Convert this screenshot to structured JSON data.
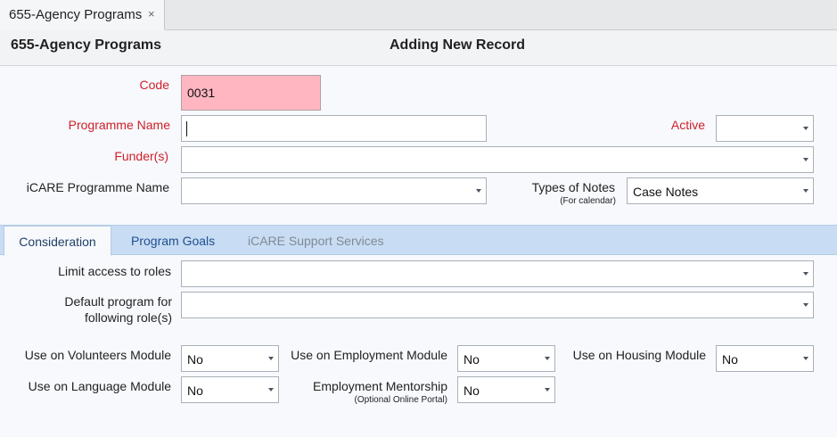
{
  "doc_tab": {
    "label": "655-Agency Programs",
    "close": "×"
  },
  "header": {
    "form_title": "655-Agency Programs",
    "mode": "Adding New Record"
  },
  "fields": {
    "code": {
      "label": "Code",
      "value": "0031"
    },
    "programme_name": {
      "label": "Programme Name",
      "value": ""
    },
    "active": {
      "label": "Active",
      "value": ""
    },
    "funders": {
      "label": "Funder(s)",
      "value": ""
    },
    "icare_programme_name": {
      "label": "iCARE Programme Name",
      "value": ""
    },
    "types_of_notes": {
      "label": "Types of Notes",
      "sublabel": "(For calendar)",
      "value": "Case Notes"
    }
  },
  "tabs": [
    {
      "label": "Consideration"
    },
    {
      "label": "Program Goals"
    },
    {
      "label": "iCARE Support Services"
    }
  ],
  "consideration": {
    "limit_access": {
      "label": "Limit access to roles",
      "value": ""
    },
    "default_program": {
      "label_line1": "Default program for",
      "label_line2": "following role(s)",
      "value": ""
    },
    "volunteers": {
      "label": "Use on Volunteers Module",
      "value": "No"
    },
    "employment": {
      "label": "Use on Employment Module",
      "value": "No"
    },
    "housing": {
      "label": "Use on Housing Module",
      "value": "No"
    },
    "language": {
      "label": "Use on Language Module",
      "value": "No"
    },
    "mentorship": {
      "label": "Employment Mentorship",
      "sublabel": "(Optional Online Portal)",
      "value": "No"
    }
  }
}
